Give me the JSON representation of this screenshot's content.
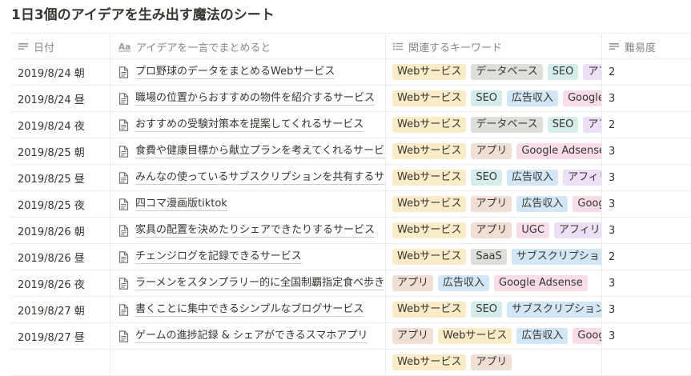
{
  "page": {
    "title": "1日3個のアイデアを生み出す魔法のシート"
  },
  "table": {
    "headers": {
      "date": {
        "label": "日付",
        "icon": "text-lines-icon"
      },
      "title": {
        "label": "アイデアを一言でまとめると",
        "icon": "aa-title-icon"
      },
      "tags": {
        "label": "関連するキーワード",
        "icon": "list-icon"
      },
      "difficulty": {
        "label": "難易度",
        "icon": "text-lines-icon"
      }
    },
    "tag_colors": {
      "Webサービス": "#fbecc9",
      "データベース": "#e0dedb",
      "SEO": "#d4ecea",
      "広告収入": "#d2e6f6",
      "アプリ": "#efdfd5",
      "Google Adsense": "#f8dce9",
      "アフィリエイト": "#ebe0f5",
      "UGC": "#f8dce9",
      "SaaS": "#e0dedb",
      "サブスクリプション": "#d2e6f6"
    },
    "rows": [
      {
        "date": "2019/8/24 朝",
        "title": "プロ野球のデータをまとめるWebサービス",
        "tags": [
          "Webサービス",
          "データベース",
          "SEO",
          "アフィリエイト"
        ],
        "difficulty": "2"
      },
      {
        "date": "2019/8/24 昼",
        "title": "職場の位置からおすすめの物件を紹介するサービス",
        "tags": [
          "Webサービス",
          "SEO",
          "広告収入",
          "Google Adsense"
        ],
        "difficulty": "3"
      },
      {
        "date": "2019/8/24 夜",
        "title": "おすすめの受験対策本を提案してくれるサービス",
        "tags": [
          "Webサービス",
          "データベース",
          "SEO",
          "アフィリエイト"
        ],
        "difficulty": "2"
      },
      {
        "date": "2019/8/25 朝",
        "title": "食費や健康目標から献立プランを考えてくれるサービス",
        "tags": [
          "Webサービス",
          "アプリ",
          "Google Adsense"
        ],
        "difficulty": "3"
      },
      {
        "date": "2019/8/25 昼",
        "title": "みんなの使っているサブスクリプションを共有するサービス",
        "tags": [
          "Webサービス",
          "SEO",
          "広告収入",
          "アフィリエイト"
        ],
        "difficulty": "3"
      },
      {
        "date": "2019/8/25 夜",
        "title": "四コマ漫画版tiktok",
        "tags": [
          "Webサービス",
          "アプリ",
          "広告収入",
          "Google Adsense"
        ],
        "difficulty": "3"
      },
      {
        "date": "2019/8/26 朝",
        "title": "家具の配置を決めたりシェアできたりするサービス",
        "tags": [
          "Webサービス",
          "アプリ",
          "UGC",
          "アフィリエイト"
        ],
        "difficulty": "3"
      },
      {
        "date": "2019/8/26 昼",
        "title": "チェンジログを記録できるサービス",
        "tags": [
          "Webサービス",
          "SaaS",
          "サブスクリプション"
        ],
        "difficulty": "2"
      },
      {
        "date": "2019/8/26 夜",
        "title": "ラーメンをスタンプラリー的に全国制覇指定食べ歩き",
        "tags": [
          "アプリ",
          "広告収入",
          "Google Adsense"
        ],
        "difficulty": "3"
      },
      {
        "date": "2019/8/27 朝",
        "title": "書くことに集中できるシンプルなブログサービス",
        "tags": [
          "Webサービス",
          "SEO",
          "サブスクリプション"
        ],
        "difficulty": "3"
      },
      {
        "date": "2019/8/27 昼",
        "title": "ゲームの進捗記録 & シェアができるスマホアプリ",
        "tags": [
          "アプリ",
          "Webサービス",
          "広告収入",
          "Google Adsense"
        ],
        "difficulty": "3"
      },
      {
        "date": "",
        "title": "",
        "tags": [
          "Webサービス",
          "アプリ"
        ],
        "difficulty": ""
      }
    ]
  }
}
